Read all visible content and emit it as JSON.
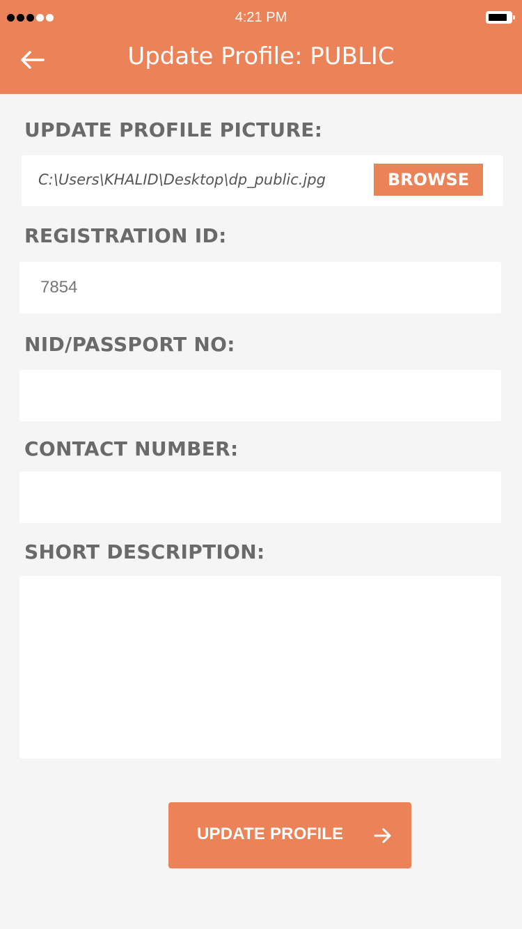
{
  "status_bar": {
    "time": "4:21 PM",
    "signal_icon": "signal-dots-icon",
    "battery_icon": "battery-icon"
  },
  "header": {
    "title": "Update Profile: PUBLIC",
    "back_icon": "arrow-left-icon",
    "background_color": "#ec8358"
  },
  "form": {
    "profile_picture": {
      "label": "UPDATE PROFILE PICTURE:",
      "file_path": "C:\\Users\\KHALID\\Desktop\\dp_public.jpg",
      "browse_label": "BROWSE"
    },
    "registration_id": {
      "label": "REGISTRATION ID:",
      "value": "7854"
    },
    "nid_passport": {
      "label": "NID/PASSPORT NO:",
      "value": ""
    },
    "contact_number": {
      "label": "CONTACT NUMBER:",
      "value": ""
    },
    "short_description": {
      "label": "SHORT DESCRIPTION:",
      "value": ""
    }
  },
  "submit": {
    "label": "UPDATE PROFILE",
    "icon": "arrow-right-icon"
  },
  "colors": {
    "accent": "#ec8358",
    "background": "#f5f5f5",
    "label_text": "#6a6a6a"
  }
}
